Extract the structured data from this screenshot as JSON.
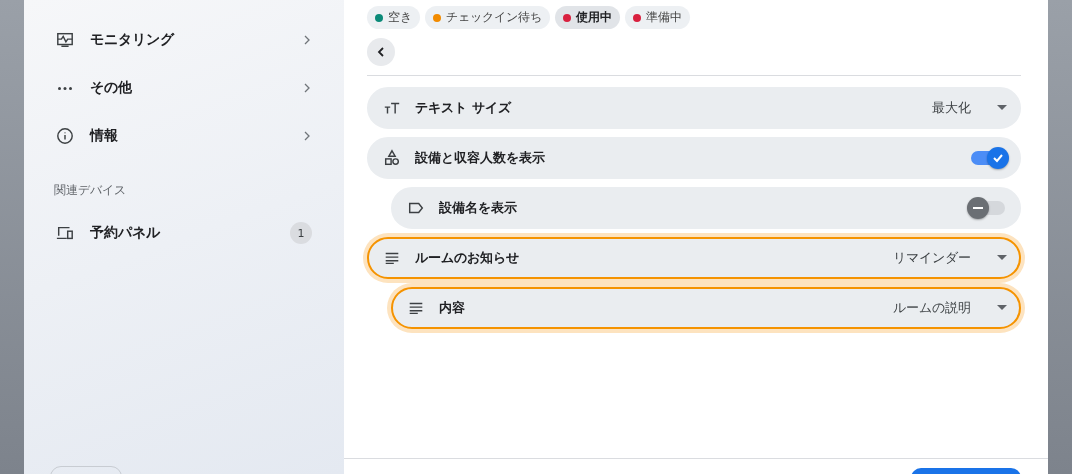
{
  "sidebar": {
    "items": [
      {
        "label": "モニタリング",
        "kind": "nav"
      },
      {
        "label": "その他",
        "kind": "nav"
      },
      {
        "label": "情報",
        "kind": "nav"
      }
    ],
    "section_title": "関連デバイス",
    "devices": [
      {
        "label": "予約パネル",
        "count": "1"
      }
    ]
  },
  "legend": [
    {
      "label": "空き",
      "color": "#0b8a78",
      "selected": false
    },
    {
      "label": "チェックイン待ち",
      "color": "#f28b00",
      "selected": false
    },
    {
      "label": "使用中",
      "color": "#d9213f",
      "selected": true
    },
    {
      "label": "準備中",
      "color": "#d9213f",
      "selected": false
    }
  ],
  "settings": [
    {
      "kind": "select",
      "label": "テキスト サイズ",
      "value": "最大化",
      "highlighted": false
    },
    {
      "kind": "toggle",
      "label": "設備と収容人数を表示",
      "on": true,
      "highlighted": false,
      "children": [
        {
          "kind": "toggle",
          "label": "設備名を表示",
          "on": false,
          "highlighted": false
        }
      ]
    },
    {
      "kind": "select",
      "label": "ルームのお知らせ",
      "value": "リマインダー",
      "highlighted": true,
      "children": [
        {
          "kind": "select",
          "label": "内容",
          "value": "ルームの説明",
          "highlighted": true
        }
      ]
    }
  ]
}
